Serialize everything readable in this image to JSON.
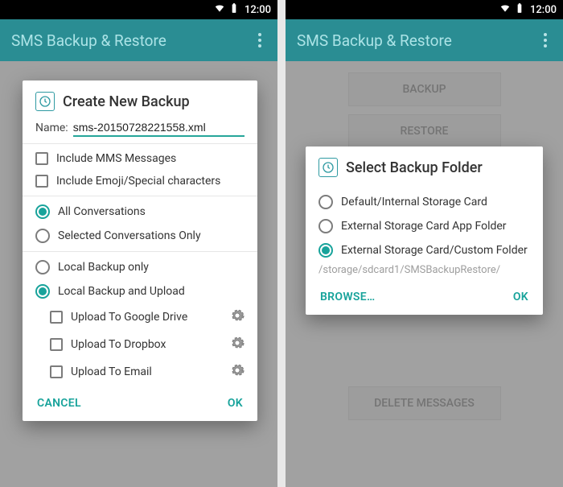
{
  "status": {
    "time": "12:00"
  },
  "appbar": {
    "title": "SMS Backup & Restore"
  },
  "bg_buttons": {
    "backup": "BACKUP",
    "restore": "RESTORE",
    "delete": "DELETE MESSAGES"
  },
  "dialog1": {
    "title": "Create New Backup",
    "name_label": "Name:",
    "name_value": "sms-20150728221558.xml",
    "include_mms": "Include MMS Messages",
    "include_emoji": "Include Emoji/Special characters",
    "scope": {
      "all": "All Conversations",
      "selected": "Selected Conversations Only"
    },
    "dest": {
      "local_only": "Local Backup only",
      "local_upload": "Local Backup and Upload",
      "upload_gdrive": "Upload To Google Drive",
      "upload_dropbox": "Upload To Dropbox",
      "upload_email": "Upload To Email"
    },
    "actions": {
      "cancel": "CANCEL",
      "ok": "OK"
    }
  },
  "dialog2": {
    "title": "Select Backup Folder",
    "opt_default": "Default/Internal Storage Card",
    "opt_external_app": "External Storage Card App Folder",
    "opt_external_custom": "External Storage Card/Custom Folder",
    "path": "/storage/sdcard1/SMSBackupRestore/",
    "actions": {
      "browse": "BROWSE…",
      "ok": "OK"
    }
  }
}
